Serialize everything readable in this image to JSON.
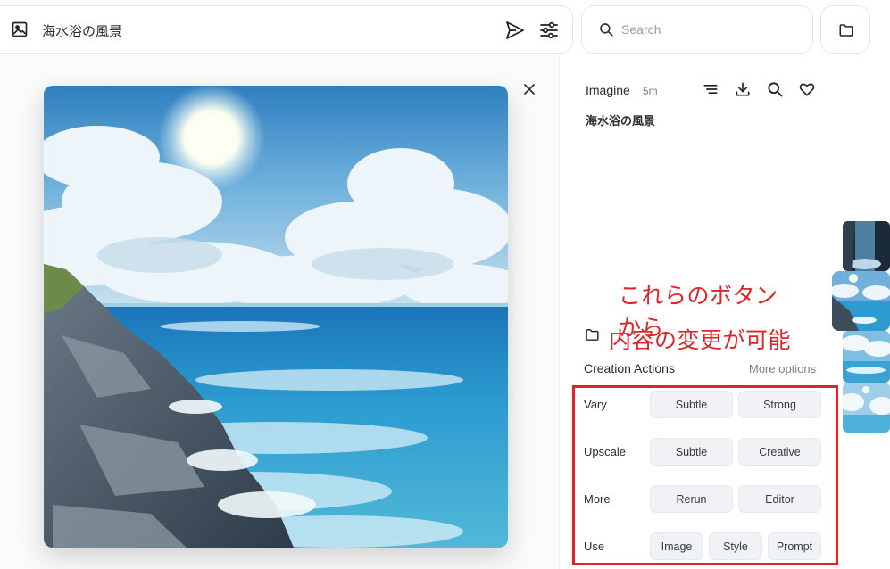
{
  "prompt_bar": {
    "text": "海水浴の風景",
    "image_icon": "image-icon",
    "send_icon": "send-icon",
    "settings_icon": "sliders-icon"
  },
  "search": {
    "placeholder": "Search",
    "value": ""
  },
  "top_folder_icon": "folder-icon",
  "viewer": {
    "close_icon": "close-icon"
  },
  "panel": {
    "model": "Imagine",
    "age": "5m",
    "tools": [
      "list-icon",
      "download-icon",
      "search-icon",
      "heart-icon"
    ],
    "prompt_title": "海水浴の風景",
    "annotation_line1": "これらのボタンから",
    "annotation_line2": "内容の変更が可能",
    "section_title": "Creation Actions",
    "more_options": "More options",
    "actions": [
      {
        "label": "Vary",
        "buttons": [
          "Subtle",
          "Strong"
        ]
      },
      {
        "label": "Upscale",
        "buttons": [
          "Subtle",
          "Creative"
        ]
      },
      {
        "label": "More",
        "buttons": [
          "Rerun",
          "Editor"
        ]
      },
      {
        "label": "Use",
        "buttons": [
          "Image",
          "Style",
          "Prompt"
        ]
      }
    ]
  },
  "colors": {
    "annotation_red": "#e0242b",
    "button_bg": "#f1f2f5",
    "border": "#e5e6ea"
  }
}
